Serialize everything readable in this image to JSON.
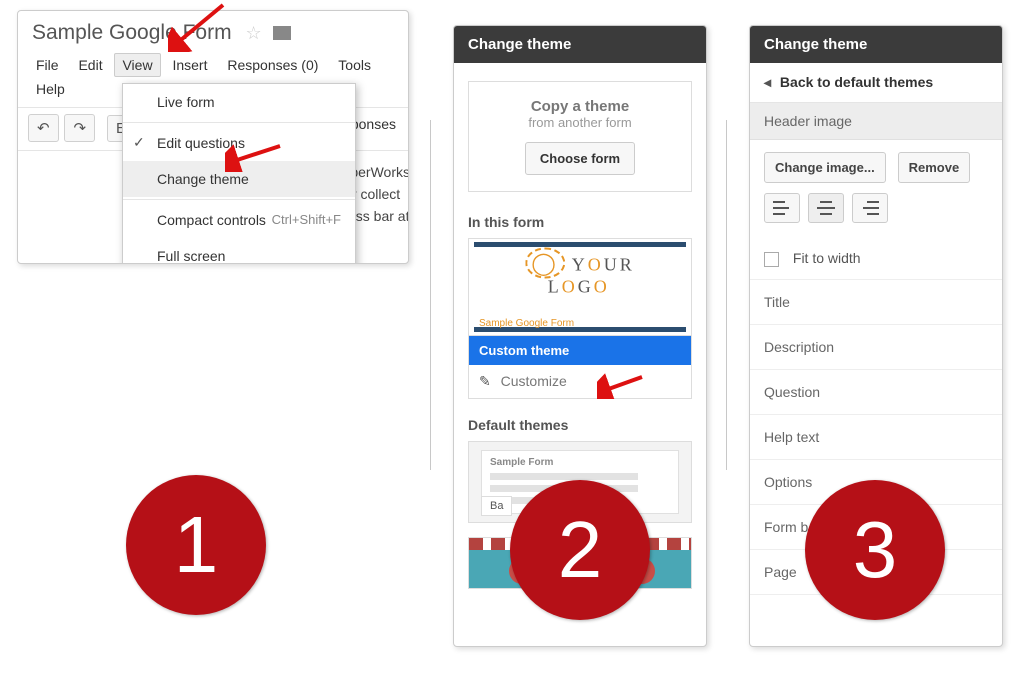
{
  "panel1": {
    "title": "Sample Google Form",
    "menus": {
      "file": "File",
      "edit": "Edit",
      "view": "View",
      "insert": "Insert",
      "responses": "Responses (0)",
      "tools": "Tools",
      "help": "Help"
    },
    "toolbar": {
      "undo": "↶",
      "redo": "↷",
      "view_responses": "responses",
      "partial_e": "E"
    },
    "dropdown": {
      "live_form": "Live form",
      "edit_questions": "Edit questions",
      "change_theme": "Change theme",
      "compact": "Compact controls",
      "compact_shortcut": "Ctrl+Shift+F",
      "full_screen": "Full screen"
    },
    "behind": {
      "l1": "/olberWorks",
      "l2": "ally collect",
      "l3": "gress bar at"
    }
  },
  "panel2": {
    "header": "Change theme",
    "copy": {
      "t1": "Copy a theme",
      "t2": "from another form",
      "btn": "Choose form"
    },
    "in_this_form": "In this form",
    "logo_line1": "Y",
    "logo_o": "O",
    "logo_rest": "UR",
    "logo_line2a": "L",
    "logo_o2": "O",
    "logo_line2b": "G",
    "logo_o3": "O",
    "sub": "Sample Google Form",
    "custom_theme": "Custom theme",
    "customize": "Customize",
    "default_themes": "Default themes",
    "basic_label": "Ba",
    "sample_form": "Sample Form"
  },
  "panel3": {
    "header": "Change theme",
    "back": "Back to default themes",
    "header_image": "Header image",
    "change_image": "Change image...",
    "remove": "Remove",
    "fit": "Fit to width",
    "rows": {
      "title": "Title",
      "desc": "Description",
      "question": "Question",
      "help": "Help text",
      "options": "Options",
      "formbg": "Form ba",
      "pagebg": "Page"
    }
  },
  "badges": {
    "b1": "1",
    "b2": "2",
    "b3": "3"
  }
}
